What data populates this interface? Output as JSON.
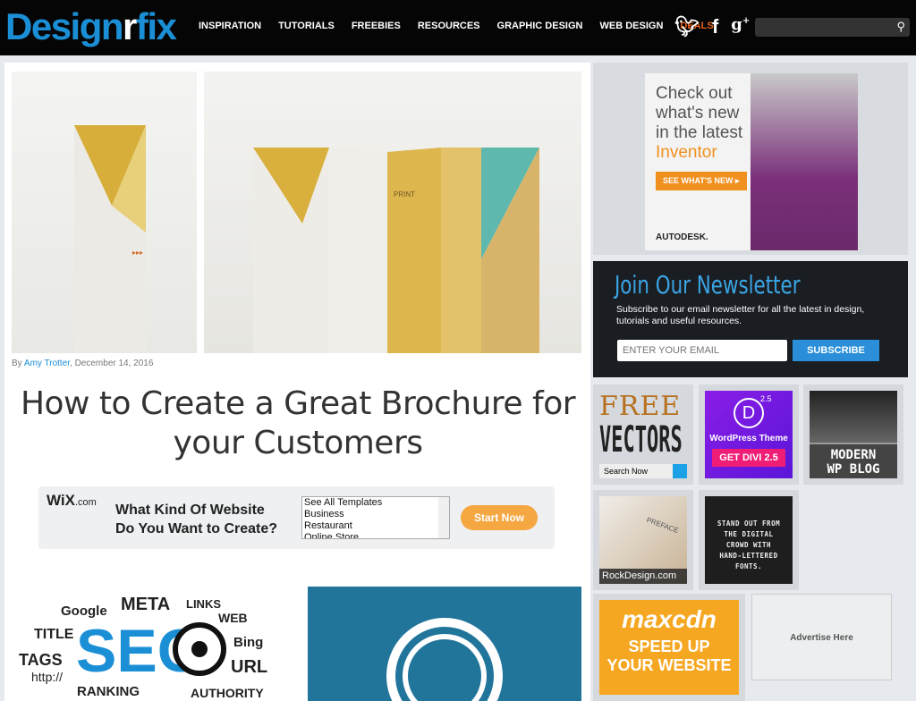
{
  "header": {
    "logo_a": "Design",
    "logo_b": "r",
    "logo_c": "fix",
    "nav": [
      "INSPIRATION",
      "TUTORIALS",
      "FREEBIES",
      "RESOURCES",
      "GRAPHIC DESIGN",
      "WEB DESIGN",
      "DEALS"
    ],
    "social": [
      "twitter-icon",
      "facebook-icon",
      "google-plus-icon"
    ],
    "search_icon": "search-icon"
  },
  "article": {
    "by": "By",
    "author": "Amy Trotter",
    "date": ", December 14, 2016",
    "title": "How to Create a Great Brochure for your Customers",
    "image_text_print": "PRINT"
  },
  "wix_ad": {
    "logo": "WiX",
    "logo_suffix": ".com",
    "question_1": "What Kind Of Website",
    "question_2": "Do You Want to Create?",
    "options": [
      "See All Templates",
      "Business",
      "Restaurant",
      "Online Store"
    ],
    "button": "Start Now",
    "accent": "#f5a742"
  },
  "seo_image": {
    "words": [
      "Google",
      "META",
      "LINKS",
      "WEB",
      "TITLE",
      "SEO",
      "Bing",
      "TAGS",
      "URL",
      "http://",
      "RANKING",
      "AUTHORITY"
    ]
  },
  "sidebar": {
    "autodesk": {
      "line1": "Check out",
      "line2": "what's new",
      "line3": "in the latest",
      "line4": "Inventor",
      "button": "SEE WHAT'S NEW ▸",
      "brand": "AUTODESK."
    },
    "newsletter": {
      "title": "Join Our Newsletter",
      "text": "Subscribe to our email newsletter for all the latest in design, tutorials and useful resources.",
      "placeholder": "ENTER YOUR EMAIL",
      "button": "SUBSCRIBE"
    },
    "ads": {
      "free": "FREE",
      "vectors": "VECTORS",
      "search_now": "Search Now",
      "divi_title": "WordPress Theme",
      "divi_btn": "GET DIVI 2.5",
      "divi_ver": "2.5",
      "modern1": "MODERN",
      "modern2": "WP BLOG",
      "rock": "RockDesign.com",
      "preface": "PREFACE",
      "fonts": "STAND OUT FROM THE DIGITAL CROWD WITH HAND-LETTERED FONTS.",
      "maxcdn": "maxcdn",
      "speed1": "SPEED UP",
      "speed2": "YOUR WEBSITE",
      "advertise": "Advertise Here"
    }
  }
}
